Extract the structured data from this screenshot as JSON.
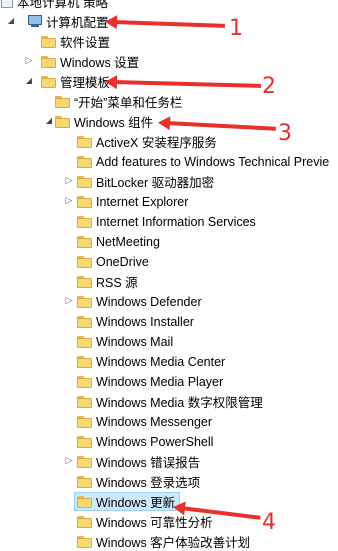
{
  "tree": {
    "root_label": "本地计算机 策略",
    "items": [
      {
        "label": "计算机配置",
        "indent": 1,
        "toggle": "expanded",
        "icon": "computer-icon"
      },
      {
        "label": "软件设置",
        "indent": 2,
        "toggle": "",
        "icon": "folder-icon"
      },
      {
        "label": "Windows 设置",
        "indent": 2,
        "toggle": "collapsed",
        "icon": "folder-icon"
      },
      {
        "label": "管理模板",
        "indent": 2,
        "toggle": "expanded",
        "icon": "folder-icon"
      },
      {
        "label": "“开始”菜单和任务栏",
        "indent": 3,
        "toggle": "",
        "icon": "folder-icon"
      },
      {
        "label": "Windows 组件",
        "indent": 3,
        "toggle": "expanded",
        "icon": "folder-icon"
      },
      {
        "label": "ActiveX 安装程序服务",
        "indent": 4,
        "toggle": "",
        "icon": "folder-icon"
      },
      {
        "label": "Add features to Windows Technical Previe",
        "indent": 4,
        "toggle": "",
        "icon": "folder-icon"
      },
      {
        "label": "BitLocker 驱动器加密",
        "indent": 4,
        "toggle": "collapsed",
        "icon": "folder-icon"
      },
      {
        "label": "Internet Explorer",
        "indent": 4,
        "toggle": "collapsed",
        "icon": "folder-icon"
      },
      {
        "label": "Internet Information Services",
        "indent": 4,
        "toggle": "",
        "icon": "folder-icon"
      },
      {
        "label": "NetMeeting",
        "indent": 4,
        "toggle": "",
        "icon": "folder-icon"
      },
      {
        "label": "OneDrive",
        "indent": 4,
        "toggle": "",
        "icon": "folder-icon"
      },
      {
        "label": "RSS 源",
        "indent": 4,
        "toggle": "",
        "icon": "folder-icon"
      },
      {
        "label": "Windows Defender",
        "indent": 4,
        "toggle": "collapsed",
        "icon": "folder-icon"
      },
      {
        "label": "Windows Installer",
        "indent": 4,
        "toggle": "",
        "icon": "folder-icon"
      },
      {
        "label": "Windows Mail",
        "indent": 4,
        "toggle": "",
        "icon": "folder-icon"
      },
      {
        "label": "Windows Media Center",
        "indent": 4,
        "toggle": "",
        "icon": "folder-icon"
      },
      {
        "label": "Windows Media Player",
        "indent": 4,
        "toggle": "",
        "icon": "folder-icon"
      },
      {
        "label": "Windows Media 数字权限管理",
        "indent": 4,
        "toggle": "",
        "icon": "folder-icon"
      },
      {
        "label": "Windows Messenger",
        "indent": 4,
        "toggle": "",
        "icon": "folder-icon"
      },
      {
        "label": "Windows PowerShell",
        "indent": 4,
        "toggle": "",
        "icon": "folder-icon"
      },
      {
        "label": "Windows 错误报告",
        "indent": 4,
        "toggle": "collapsed",
        "icon": "folder-icon"
      },
      {
        "label": "Windows 登录选项",
        "indent": 4,
        "toggle": "",
        "icon": "folder-icon"
      },
      {
        "label": "Windows 更新",
        "indent": 4,
        "toggle": "",
        "icon": "folder-icon",
        "selected": true
      },
      {
        "label": "Windows 可靠性分析",
        "indent": 4,
        "toggle": "",
        "icon": "folder-icon"
      },
      {
        "label": "Windows 客户体验改善计划",
        "indent": 4,
        "toggle": "",
        "icon": "folder-icon"
      }
    ]
  },
  "annotations": {
    "marker_1": "1",
    "marker_2": "2",
    "marker_3": "3",
    "marker_4": "4"
  },
  "colors": {
    "arrow": "#e8302c",
    "selection": "#cde8ff"
  }
}
